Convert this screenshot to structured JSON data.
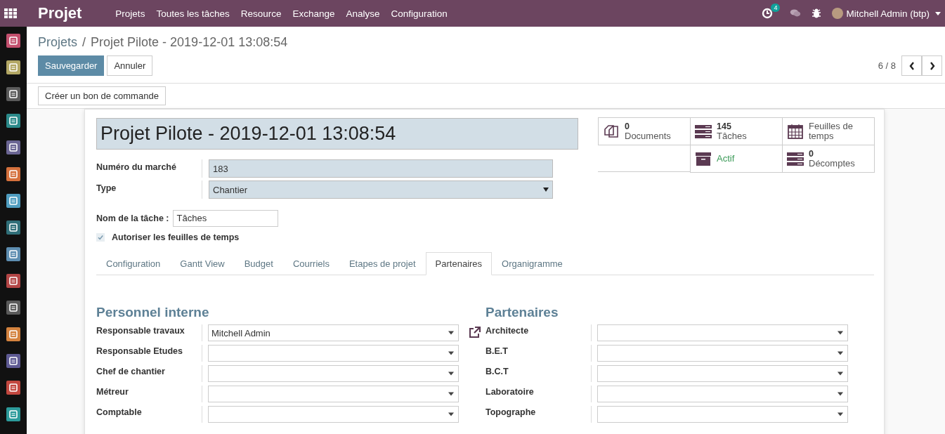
{
  "topbar": {
    "app_title": "Projet",
    "menu": [
      {
        "label": "Projets"
      },
      {
        "label": "Toutes les tâches"
      },
      {
        "label": "Resource"
      },
      {
        "label": "Exchange"
      },
      {
        "label": "Analyse"
      },
      {
        "label": "Configuration"
      }
    ],
    "activity_count": "4",
    "user": "Mitchell Admin (btp)"
  },
  "sidebar": {
    "apps": [
      {
        "color": "#c3506e"
      },
      {
        "color": "#b3a764"
      },
      {
        "color": "#5a5a5a"
      },
      {
        "color": "#2b8a8a"
      },
      {
        "color": "#6a6593"
      },
      {
        "color": "#d4703c"
      },
      {
        "color": "#4f9dc0"
      },
      {
        "color": "#2f6e78"
      },
      {
        "color": "#5d8db0"
      },
      {
        "color": "#b34646"
      },
      {
        "color": "#5a5a5a"
      },
      {
        "color": "#d3823e"
      },
      {
        "color": "#5e5a93"
      },
      {
        "color": "#c2473f"
      },
      {
        "color": "#2c9a9a"
      }
    ]
  },
  "breadcrumb": {
    "separator": "/",
    "items": [
      {
        "label": "Projets"
      },
      {
        "label": "Projet Pilote - 2019-12-01 13:08:54"
      }
    ]
  },
  "actions": {
    "save": "Sauvegarder",
    "discard": "Annuler",
    "pager": "6 / 8"
  },
  "header_buttons": [
    "Créer un bon de commande"
  ],
  "form": {
    "title": "Projet Pilote - 2019-12-01 13:08:54",
    "stats": [
      {
        "kind": "documents",
        "value": "0",
        "label": "Documents"
      },
      {
        "kind": "tasks",
        "value": "145",
        "label": "Tâches"
      },
      {
        "kind": "timesheets",
        "label": "Feuilles de temps"
      },
      {
        "kind": "empty"
      },
      {
        "kind": "active",
        "label": "Actif"
      },
      {
        "kind": "tasks",
        "value": "0",
        "label": "Décomptes"
      }
    ],
    "fields": [
      {
        "label": "Numéro du marché",
        "value": "183",
        "kind": "text"
      },
      {
        "label": "Type",
        "value": "Chantier",
        "kind": "select"
      }
    ],
    "task_name": {
      "label": "Nom de la tâche :",
      "value": "Tâches"
    },
    "allow_timesheets": {
      "label": "Autoriser les feuilles de temps",
      "checked": true
    },
    "tabs": [
      {
        "label": "Configuration",
        "selected": false
      },
      {
        "label": "Gantt View",
        "selected": false
      },
      {
        "label": "Budget",
        "selected": false
      },
      {
        "label": "Courriels",
        "selected": false
      },
      {
        "label": "Etapes de projet",
        "selected": false
      },
      {
        "label": "Partenaires",
        "selected": true
      },
      {
        "label": "Organigramme",
        "selected": false
      }
    ],
    "groups": [
      {
        "title": "Personnel interne",
        "rows": [
          {
            "label": "Responsable travaux",
            "value": "Mitchell Admin",
            "external_link": true
          },
          {
            "label": "Responsable Etudes",
            "external_link": false
          },
          {
            "label": "Chef de chantier",
            "external_link": false
          },
          {
            "label": "Métreur",
            "external_link": false
          },
          {
            "label": "Comptable",
            "external_link": false
          }
        ]
      },
      {
        "title": "Partenaires",
        "rows": [
          {
            "label": "Architecte",
            "external_link": false
          },
          {
            "label": "B.E.T",
            "external_link": false
          },
          {
            "label": "B.C.T",
            "external_link": false
          },
          {
            "label": "Laboratoire",
            "external_link": false
          },
          {
            "label": "Topographe",
            "external_link": false
          }
        ]
      }
    ]
  }
}
